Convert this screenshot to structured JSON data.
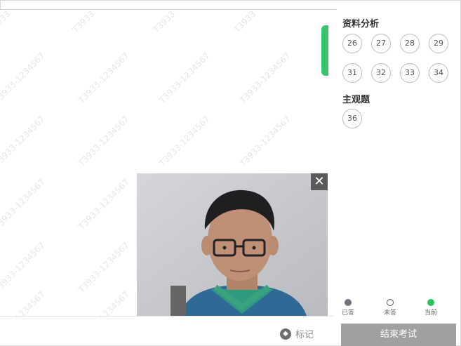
{
  "watermark_text": "T3933-1234567",
  "watermark_short": "T3933",
  "panel": {
    "section1_title": "资料分析",
    "section1_questions": [
      "26",
      "27",
      "28",
      "29",
      "31",
      "32",
      "33",
      "34"
    ],
    "section2_title": "主观题",
    "section2_questions": [
      "36"
    ],
    "legend": [
      {
        "label": "已答",
        "color": "#6f7580"
      },
      {
        "label": "未答",
        "color": "#ffffff"
      },
      {
        "label": "当前",
        "color": "#27c35a"
      }
    ],
    "end_button": "结束考试"
  },
  "bottom": {
    "mark_label": "标记",
    "mark_icon": "pin-icon"
  },
  "webcam": {
    "close_symbol": "✕"
  },
  "colors": {
    "accent_green": "#37c46a",
    "end_button_bg": "#a0a0a0"
  }
}
